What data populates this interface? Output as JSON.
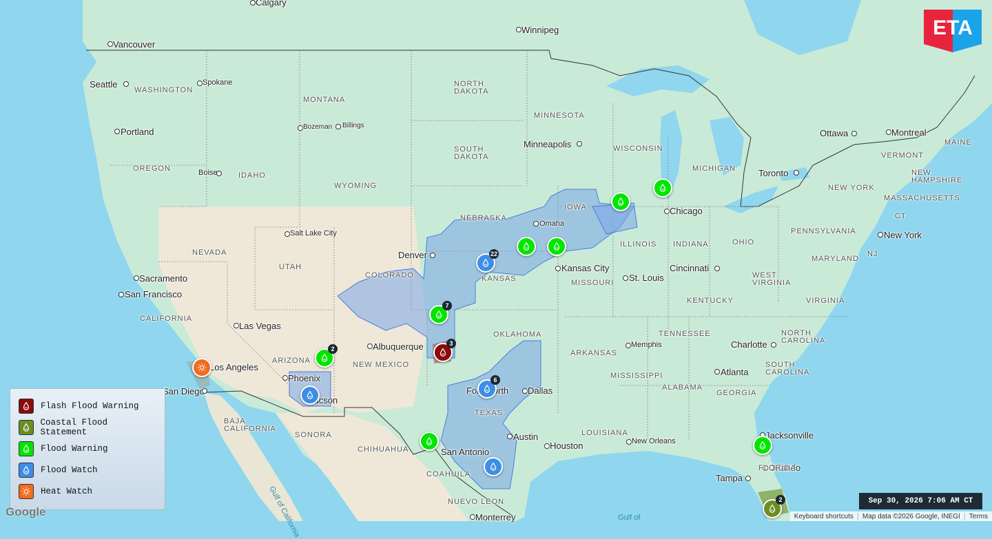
{
  "map": {
    "cities": [
      {
        "name": "Calgary"
      },
      {
        "name": "Winnipeg"
      },
      {
        "name": "Vancouver"
      },
      {
        "name": "Seattle"
      },
      {
        "name": "Spokane"
      },
      {
        "name": "Portland"
      },
      {
        "name": "Bozeman"
      },
      {
        "name": "Billings"
      },
      {
        "name": "Minneapolis"
      },
      {
        "name": "Ottawa"
      },
      {
        "name": "Montreal"
      },
      {
        "name": "Toronto"
      },
      {
        "name": "Boise"
      },
      {
        "name": "Salt Lake City"
      },
      {
        "name": "Omaha"
      },
      {
        "name": "Chicago"
      },
      {
        "name": "Denver"
      },
      {
        "name": "Kansas City"
      },
      {
        "name": "St. Louis"
      },
      {
        "name": "Cincinnati"
      },
      {
        "name": "New York"
      },
      {
        "name": "Sacramento"
      },
      {
        "name": "San Francisco"
      },
      {
        "name": "Las Vegas"
      },
      {
        "name": "Albuquerque"
      },
      {
        "name": "Memphis"
      },
      {
        "name": "Charlotte"
      },
      {
        "name": "Los Angeles"
      },
      {
        "name": "Phoenix"
      },
      {
        "name": "San Diego"
      },
      {
        "name": "Tucson"
      },
      {
        "name": "Fort Worth"
      },
      {
        "name": "Dallas"
      },
      {
        "name": "Atlanta"
      },
      {
        "name": "Jacksonville"
      },
      {
        "name": "Austin"
      },
      {
        "name": "Houston"
      },
      {
        "name": "New Orleans"
      },
      {
        "name": "San Antonio"
      },
      {
        "name": "Orlando"
      },
      {
        "name": "Tampa"
      },
      {
        "name": "Monterrey"
      }
    ],
    "regions": [
      "WASHINGTON",
      "MONTANA",
      "NORTH DAKOTA",
      "MINNESOTA",
      "OREGON",
      "IDAHO",
      "SOUTH DAKOTA",
      "WISCONSIN",
      "MICHIGAN",
      "WYOMING",
      "NEBRASKA",
      "IOWA",
      "NEW YORK",
      "NEVADA",
      "UTAH",
      "COLORADO",
      "KANSAS",
      "ILLINOIS",
      "INDIANA",
      "OHIO",
      "PENNSYLVANIA",
      "MISSOURI",
      "WEST VIRGINIA",
      "VIRGINIA",
      "KENTUCKY",
      "CALIFORNIA",
      "ARIZONA",
      "NEW MEXICO",
      "OKLAHOMA",
      "ARKANSAS",
      "TENNESSEE",
      "NORTH CAROLINA",
      "SOUTH CAROLINA",
      "MISSISSIPPI",
      "ALABAMA",
      "GEORGIA",
      "TEXAS",
      "LOUISIANA",
      "FLORIDA",
      "MAINE",
      "VERMONT",
      "NEW HAMPSHIRE",
      "MASSACHUSETTS",
      "CT",
      "NJ",
      "MARYLAND",
      "BAJA CALIFORNIA",
      "SONORA",
      "CHIHUAHUA",
      "COAHUILA",
      "NUEVO LEON"
    ],
    "water_labels": [
      "Gulf of California",
      "Gulf of"
    ]
  },
  "markers": [
    {
      "type": "flood-warning",
      "count": ""
    },
    {
      "type": "flood-warning",
      "count": ""
    },
    {
      "type": "flood-warning",
      "count": ""
    },
    {
      "type": "flood-warning",
      "count": ""
    },
    {
      "type": "flood-watch",
      "count": "22"
    },
    {
      "type": "flood-warning",
      "count": "7"
    },
    {
      "type": "flash-flood-warning",
      "count": "3"
    },
    {
      "type": "flood-warning",
      "count": "2"
    },
    {
      "type": "heat-watch",
      "count": ""
    },
    {
      "type": "flood-watch",
      "count": ""
    },
    {
      "type": "flood-watch",
      "count": "6"
    },
    {
      "type": "flood-warning",
      "count": ""
    },
    {
      "type": "flood-watch",
      "count": ""
    },
    {
      "type": "flood-warning",
      "count": ""
    },
    {
      "type": "coastal-flood-statement",
      "count": "2"
    }
  ],
  "legend": {
    "items": [
      {
        "label": "Flash Flood Warning",
        "color": "#8b0a0a",
        "icon": "flood-icon"
      },
      {
        "label": "Coastal Flood Statement",
        "color": "#6b8e23",
        "icon": "flood-icon"
      },
      {
        "label": "Flood Warning",
        "color": "#00e600",
        "icon": "flood-icon"
      },
      {
        "label": "Flood Watch",
        "color": "#3d8ee6",
        "icon": "flood-icon"
      },
      {
        "label": "Heat Watch",
        "color": "#f26b1d",
        "icon": "sun-icon"
      }
    ]
  },
  "timestamp": "Sep 30, 2026 7:06 AM CT",
  "logo": {
    "text": "ETA",
    "colors": {
      "red": "#e8243c",
      "blue": "#1aa3e8"
    }
  },
  "attribution": {
    "google": "Google",
    "shortcuts": "Keyboard shortcuts",
    "map_data": "Map data ©2026 Google, INEGI",
    "terms": "Terms"
  },
  "colors": {
    "water": "#8fd6ee",
    "land_us": "#c8ead6",
    "land_canada": "#bfe6d0",
    "land_desert": "#efe8d8",
    "flood_watch_fill": "#7aa6e8"
  }
}
